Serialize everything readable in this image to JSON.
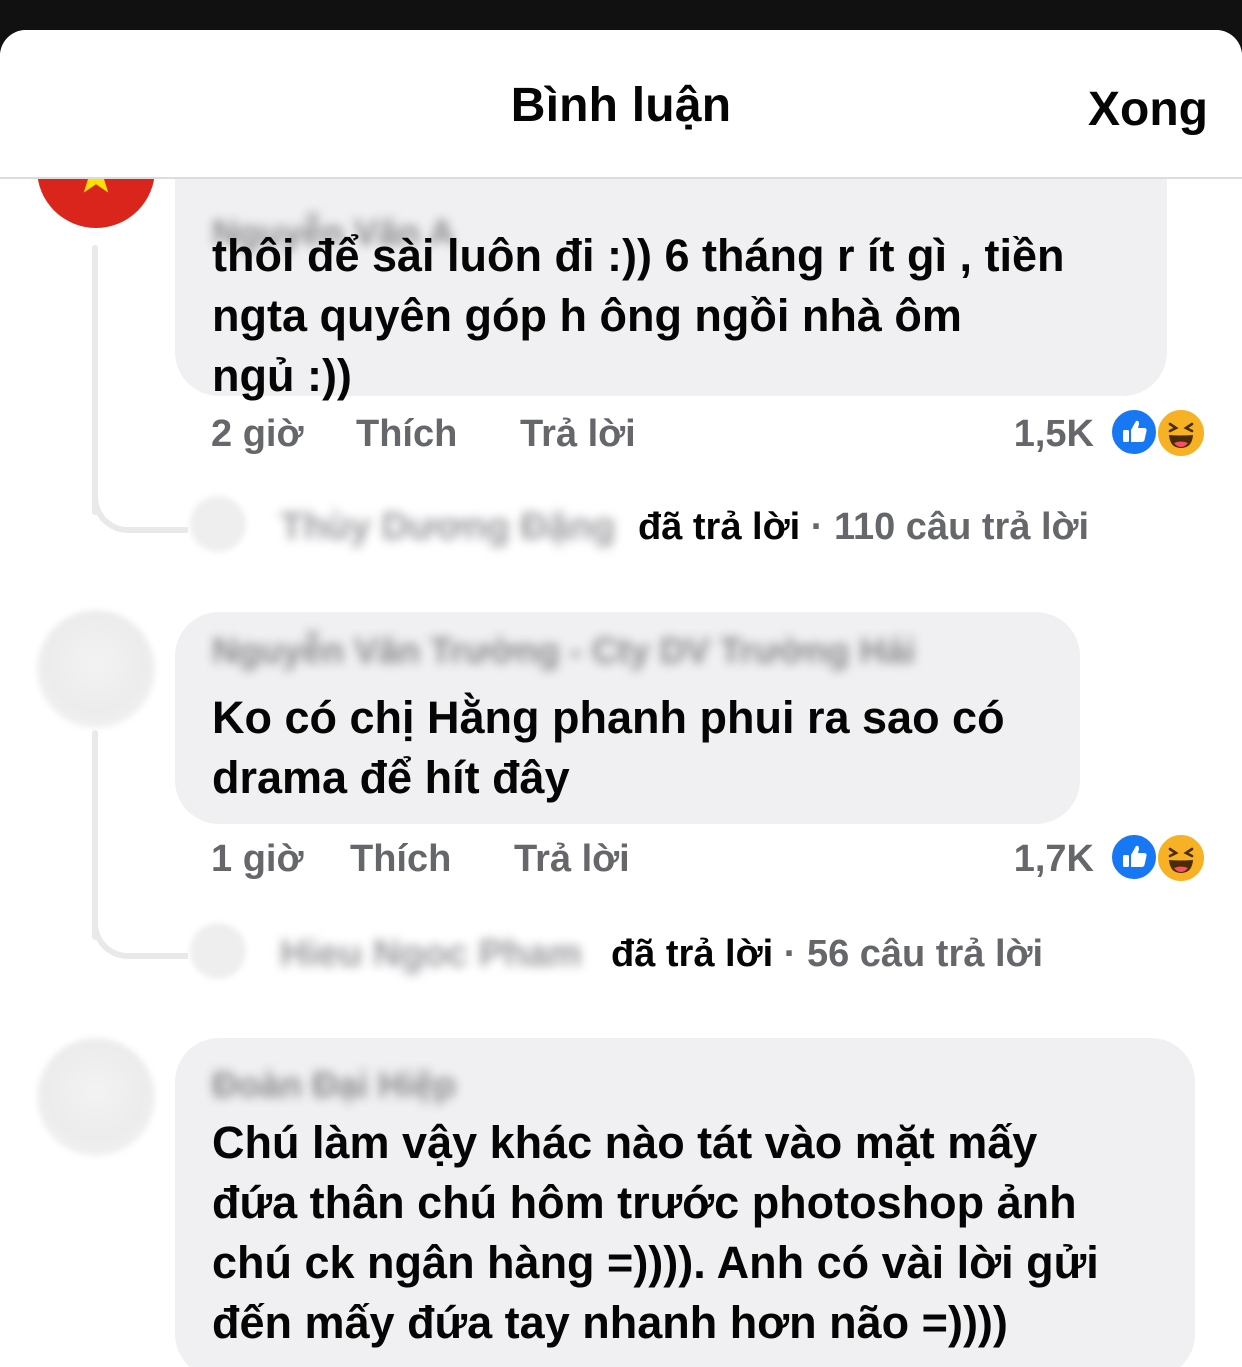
{
  "header": {
    "title": "Bình luận",
    "done_label": "Xong"
  },
  "comments": [
    {
      "author": "Nguyễn Văn A",
      "lines": [
        "thôi để sài luôn đi :)) 6 tháng r ít gì , tiền",
        "ngta quyên góp h ông ngồi nhà ôm",
        "ngủ :))"
      ],
      "time": "2 giờ",
      "like_label": "Thích",
      "reply_label": "Trả lời",
      "reaction_count": "1,5K",
      "reactions": [
        "like-icon",
        "haha-icon"
      ],
      "replies": {
        "name": "Thùy Dương Đặng",
        "replied_label": "đã trả lời",
        "count_label": "· 110 câu trả lời"
      }
    },
    {
      "author": "Nguyễn Văn Trường - Cty DV Trường Hải",
      "lines": [
        "Ko có chị Hằng phanh phui ra sao có",
        "drama để hít đây"
      ],
      "time": "1 giờ",
      "like_label": "Thích",
      "reply_label": "Trả lời",
      "reaction_count": "1,7K",
      "reactions": [
        "like-icon",
        "haha-icon"
      ],
      "replies": {
        "name": "Hieu Ngoc Pham",
        "replied_label": "đã trả lời",
        "count_label": "· 56 câu trả lời"
      }
    },
    {
      "author": "Đoàn Đại Hiệp",
      "lines": [
        "Chú làm vậy khác nào tát vào mặt mấy",
        "đứa thân chú hôm trước photoshop ảnh",
        "chú ck ngân hàng =)))). Anh có vài lời gửi",
        "đến mấy đứa tay nhanh hơn não =))))"
      ]
    }
  ],
  "colors": {
    "bubble": "#f0f0f2",
    "meta_text": "#65676b",
    "like_blue": "#1877f2",
    "haha_yellow": "#f7b125",
    "flag_red": "#da251d",
    "flag_star": "#ffde00"
  }
}
